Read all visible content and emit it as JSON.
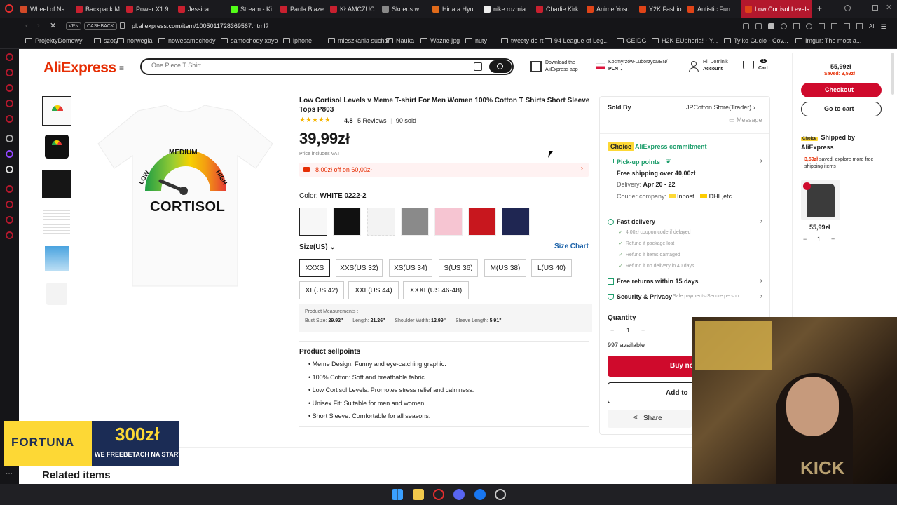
{
  "browser": {
    "tabs": [
      {
        "label": "Wheel of Na",
        "color": "#d24a28"
      },
      {
        "label": "Backpack M",
        "color": "#c8202f"
      },
      {
        "label": "Power X1 9",
        "color": "#c8202f"
      },
      {
        "label": "Jessica",
        "color": "#c8202f"
      },
      {
        "label": "Stream - Ki",
        "color": "#53fc18"
      },
      {
        "label": "Paola Blaze",
        "color": "#c8202f"
      },
      {
        "label": "KŁAMCZUC",
        "color": "#c8202f"
      },
      {
        "label": "Skoeus w",
        "color": "#888888"
      },
      {
        "label": "Hinata Hyu",
        "color": "#e06a1a"
      },
      {
        "label": "nike rozmia",
        "color": "#eeeeee"
      },
      {
        "label": "Charlie Kirk",
        "color": "#c8202f"
      },
      {
        "label": "Anime Yosu",
        "color": "#e04418"
      },
      {
        "label": "Y2K Fashio",
        "color": "#e04418"
      },
      {
        "label": "Autistic Fun",
        "color": "#e04418"
      },
      {
        "label": "Low Cortisol Levels v",
        "color": "#e04418"
      }
    ],
    "url": "pl.aliexpress.com/item/1005011728369567.html?",
    "vpn_label": "VPN",
    "cashback_label": "CASHBACK",
    "bookmarks": [
      "ProjektyDomowy",
      "szoty",
      "norwegia",
      "nowesamochody",
      "samochody xayo",
      "iphone",
      "mieszkania suchar",
      "Nauka",
      "Ważne jpg",
      "nuty",
      "tweety do rt",
      "94 League of Leg...",
      "CEIDG",
      "H2K EUphoria! - Y...",
      "Tylko Gucio - Cov...",
      "Imgur: The most a..."
    ]
  },
  "header": {
    "logo": "AliExpress",
    "search_placeholder": "One Piece T Shirt",
    "download_line1": "Download the",
    "download_line2": "AliExpress app",
    "location": "Kocmyrzów-Luborzyca/EN/",
    "currency": "PLN",
    "greeting": "Hi, Dominik",
    "account": "Account",
    "cart_label": "Cart",
    "cart_count": "1"
  },
  "product": {
    "title_line1": "Low Cortisol Levels v Meme T-shirt For Men Women 100% Cotton T Shirts Short Sleeve",
    "title_line2": "Tops P803",
    "rating": "4.8",
    "reviews": "5 Reviews",
    "sold": "90 sold",
    "price": "39,99zł",
    "vat_note": "Price includes VAT",
    "coupon": "8,00zł off on 60,00zł",
    "color_label": "Color: ",
    "color_value": "WHITE 0222-2",
    "size_label": "Size(US)",
    "size_chart": "Size Chart",
    "sizes": [
      "XXXS",
      "XXS(US 32)",
      "XS(US 34)",
      "S(US 36)",
      "M(US 38)",
      "L(US 40)",
      "XL(US 42)",
      "XXL(US 44)",
      "XXXL(US 46-48)"
    ],
    "measurements_title": "Product Measurements :",
    "bust_label": "Bust Size:",
    "bust": "29.92\"",
    "length_label": "Length:",
    "length": "21.26\"",
    "shoulder_label": "Shoulder Width:",
    "shoulder": "12.99\"",
    "sleeve_label": "Sleeve Length:",
    "sleeve": "5.91\"",
    "sellpoints_title": "Product sellpoints",
    "sellpoints": [
      "Meme Design: Funny and eye-catching graphic.",
      "100% Cotton: Soft and breathable fabric.",
      "Low Cortisol Levels: Promotes stress relief and calmness.",
      "Unisex Fit: Suitable for men and women.",
      "Short Sleeve: Comfortable for all seasons."
    ],
    "gauge_top": "MEDIUM",
    "gauge_left": "LOW",
    "gauge_right": "HIGH",
    "gauge_main": "CORTISOL"
  },
  "seller": {
    "sold_by": "Sold By",
    "store": "JPCotton Store(Trader)",
    "message": "Message",
    "choice": "Choice",
    "commitment": "AliExpress commitment",
    "pickup": "Pick-up points",
    "free_shipping": "Free shipping over 40,00zł",
    "delivery_label": "Delivery: ",
    "delivery_dates": "Apr 20 - 22",
    "courier_label": "Courier company: ",
    "courier1": "Inpost",
    "courier2": "DHL",
    "courier_etc": ",etc.",
    "fast_delivery": "Fast delivery",
    "fast_items": [
      "4,00zł coupon code if delayed",
      "Refund if package lost",
      "Refund if items damaged",
      "Refund if no delivery in 40 days"
    ],
    "free_returns": "Free returns within 15 days",
    "security": "Security & Privacy",
    "security_note": "Safe payments·Secure person...",
    "quantity_label": "Quantity",
    "quantity": "1",
    "available": "997 available",
    "buy_now": "Buy no",
    "add_to": "Add to",
    "share": "Share"
  },
  "cart_panel": {
    "total": "55,99zł",
    "saved": "Saved: 3,59zł",
    "checkout": "Checkout",
    "go_to_cart": "Go to cart",
    "choice": "Choice",
    "shipped_by": "Shipped by",
    "shipped_by2": "AliExpress",
    "saved_note_amount": "3,59zł",
    "saved_note": " saved, explore more free shipping items",
    "item_price": "55,99zł",
    "item_qty": "1"
  },
  "related_title": "Related items",
  "ad": {
    "brand": "FORTUNA",
    "amount": "300zł",
    "tagline": "WE FREEBETACH NA START"
  },
  "overlay": {
    "text": "KICK"
  },
  "colors": {
    "brand_red": "#e62e04",
    "button_red": "#cf0a2c",
    "choice_yellow": "#fdd835",
    "teal": "#1e9e6c"
  }
}
